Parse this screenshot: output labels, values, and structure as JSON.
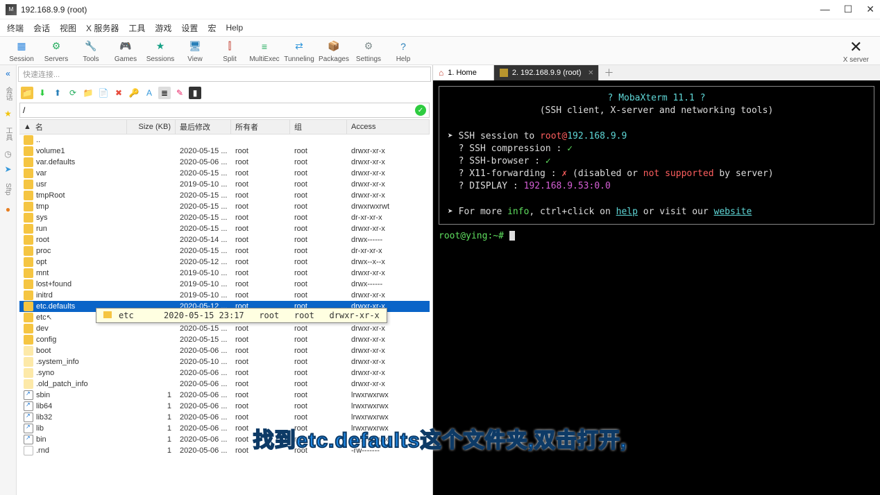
{
  "window": {
    "title": "192.168.9.9 (root)"
  },
  "menu": [
    "终端",
    "会话",
    "视图",
    "X 服务器",
    "工具",
    "游戏",
    "设置",
    "宏",
    "Help"
  ],
  "toolbar": [
    {
      "label": "Session",
      "color": "#2e86de",
      "glyph": "▦"
    },
    {
      "label": "Servers",
      "color": "#27ae60",
      "glyph": "⚙"
    },
    {
      "label": "Tools",
      "color": "#e67e22",
      "glyph": "🔧"
    },
    {
      "label": "Games",
      "color": "#8e44ad",
      "glyph": "🎮"
    },
    {
      "label": "Sessions",
      "color": "#16a085",
      "glyph": "★"
    },
    {
      "label": "View",
      "color": "#2980b9",
      "glyph": "🖥"
    },
    {
      "label": "Split",
      "color": "#c0392b",
      "glyph": "⫿"
    },
    {
      "label": "MultiExec",
      "color": "#27ae60",
      "glyph": "≡"
    },
    {
      "label": "Tunneling",
      "color": "#3498db",
      "glyph": "⇄"
    },
    {
      "label": "Packages",
      "color": "#d35400",
      "glyph": "📦"
    },
    {
      "label": "Settings",
      "color": "#7f8c8d",
      "glyph": "⚙"
    },
    {
      "label": "Help",
      "color": "#2980b9",
      "glyph": "?"
    }
  ],
  "xserver_label": "X server",
  "quickconnect_placeholder": "快速连接...",
  "current_path": "/",
  "columns": {
    "name": "名",
    "size": "Size (KB)",
    "modified": "最后修改",
    "owner": "所有者",
    "group": "组",
    "access": "Access"
  },
  "sidebar_labels": {
    "sessions": "会话",
    "tools": "工具",
    "sftp": "Sftp"
  },
  "files": [
    {
      "name": "volume1",
      "type": "folder",
      "size": "",
      "mod": "2020-05-15 ...",
      "owner": "root",
      "group": "root",
      "access": "drwxr-xr-x"
    },
    {
      "name": "var.defaults",
      "type": "folder",
      "size": "",
      "mod": "2020-05-06 ...",
      "owner": "root",
      "group": "root",
      "access": "drwxr-xr-x"
    },
    {
      "name": "var",
      "type": "folder",
      "size": "",
      "mod": "2020-05-15 ...",
      "owner": "root",
      "group": "root",
      "access": "drwxr-xr-x"
    },
    {
      "name": "usr",
      "type": "folder",
      "size": "",
      "mod": "2019-05-10 ...",
      "owner": "root",
      "group": "root",
      "access": "drwxr-xr-x"
    },
    {
      "name": "tmpRoot",
      "type": "folder",
      "size": "",
      "mod": "2020-05-15 ...",
      "owner": "root",
      "group": "root",
      "access": "drwxr-xr-x"
    },
    {
      "name": "tmp",
      "type": "folder",
      "size": "",
      "mod": "2020-05-15 ...",
      "owner": "root",
      "group": "root",
      "access": "drwxrwxrwt"
    },
    {
      "name": "sys",
      "type": "folder",
      "size": "",
      "mod": "2020-05-15 ...",
      "owner": "root",
      "group": "root",
      "access": "dr-xr-xr-x"
    },
    {
      "name": "run",
      "type": "folder",
      "size": "",
      "mod": "2020-05-15 ...",
      "owner": "root",
      "group": "root",
      "access": "drwxr-xr-x"
    },
    {
      "name": "root",
      "type": "folder",
      "size": "",
      "mod": "2020-05-14 ...",
      "owner": "root",
      "group": "root",
      "access": "drwx------"
    },
    {
      "name": "proc",
      "type": "folder",
      "size": "",
      "mod": "2020-05-15 ...",
      "owner": "root",
      "group": "root",
      "access": "dr-xr-xr-x"
    },
    {
      "name": "opt",
      "type": "folder",
      "size": "",
      "mod": "2020-05-12 ...",
      "owner": "root",
      "group": "root",
      "access": "drwx--x--x"
    },
    {
      "name": "mnt",
      "type": "folder",
      "size": "",
      "mod": "2019-05-10 ...",
      "owner": "root",
      "group": "root",
      "access": "drwxr-xr-x"
    },
    {
      "name": "lost+found",
      "type": "folder",
      "size": "",
      "mod": "2019-05-10 ...",
      "owner": "root",
      "group": "root",
      "access": "drwx------"
    },
    {
      "name": "initrd",
      "type": "folder",
      "size": "",
      "mod": "2019-05-10 ...",
      "owner": "root",
      "group": "root",
      "access": "drwxr-xr-x"
    },
    {
      "name": "etc.defaults",
      "type": "folder",
      "size": "",
      "mod": "2020-05-12 ...",
      "owner": "root",
      "group": "root",
      "access": "drwxr-xr-x",
      "selected": true
    },
    {
      "name": "etc",
      "type": "folder",
      "size": "",
      "mod": "2020-05-15 ...",
      "owner": "root",
      "group": "root",
      "access": "drwxr-xr-x",
      "cursor": true
    },
    {
      "name": "dev",
      "type": "folder",
      "size": "",
      "mod": "2020-05-15 ...",
      "owner": "root",
      "group": "root",
      "access": "drwxr-xr-x"
    },
    {
      "name": "config",
      "type": "folder",
      "size": "",
      "mod": "2020-05-15 ...",
      "owner": "root",
      "group": "root",
      "access": "drwxr-xr-x"
    },
    {
      "name": "boot",
      "type": "folder-lt",
      "size": "",
      "mod": "2020-05-06 ...",
      "owner": "root",
      "group": "root",
      "access": "drwxr-xr-x"
    },
    {
      "name": ".system_info",
      "type": "folder-lt",
      "size": "",
      "mod": "2020-05-10 ...",
      "owner": "root",
      "group": "root",
      "access": "drwxr-xr-x"
    },
    {
      "name": ".syno",
      "type": "folder-lt",
      "size": "",
      "mod": "2020-05-06 ...",
      "owner": "root",
      "group": "root",
      "access": "drwxr-xr-x"
    },
    {
      "name": ".old_patch_info",
      "type": "folder-lt",
      "size": "",
      "mod": "2020-05-06 ...",
      "owner": "root",
      "group": "root",
      "access": "drwxr-xr-x"
    },
    {
      "name": "sbin",
      "type": "link",
      "size": "1",
      "mod": "2020-05-06 ...",
      "owner": "root",
      "group": "root",
      "access": "lrwxrwxrwx"
    },
    {
      "name": "lib64",
      "type": "link",
      "size": "1",
      "mod": "2020-05-06 ...",
      "owner": "root",
      "group": "root",
      "access": "lrwxrwxrwx"
    },
    {
      "name": "lib32",
      "type": "link",
      "size": "1",
      "mod": "2020-05-06 ...",
      "owner": "root",
      "group": "root",
      "access": "lrwxrwxrwx"
    },
    {
      "name": "lib",
      "type": "link",
      "size": "1",
      "mod": "2020-05-06 ...",
      "owner": "root",
      "group": "root",
      "access": "lrwxrwxrwx"
    },
    {
      "name": "bin",
      "type": "link",
      "size": "1",
      "mod": "2020-05-06 ...",
      "owner": "root",
      "group": "root",
      "access": "lrwxrwxrwx"
    },
    {
      "name": ".rnd",
      "type": "file",
      "size": "1",
      "mod": "2020-05-06 ...",
      "owner": "root",
      "group": "root",
      "access": "-rw-------"
    }
  ],
  "tooltip": {
    "name": "etc",
    "mod": "2020-05-15 23:17",
    "owner": "root",
    "group": "root",
    "access": "drwxr-xr-x"
  },
  "tabs": {
    "home": "1. Home",
    "session": "2. 192.168.9.9 (root)"
  },
  "terminal": {
    "banner_title": "? MobaXterm 11.1 ?",
    "banner_sub": "(SSH client, X-server and networking tools)",
    "ssh_line_prefix": "SSH session to ",
    "ssh_user": "root@",
    "ssh_host": "192.168.9.9",
    "compression": "? SSH compression : ",
    "browser": "? SSH-browser     : ",
    "x11_label": "? X11-forwarding  : ",
    "x11_status": "  (disabled or ",
    "x11_not": "not supported",
    "x11_tail": " by server)",
    "display_label": "? DISPLAY         : ",
    "display_val": "192.168.9.53:0.0",
    "info_line1": "➤ For more ",
    "info_word": "info",
    "info_line2": ", ctrl+click on ",
    "help": "help",
    "info_line3": " or visit our ",
    "website": "website",
    "prompt": "root@ying:~# "
  },
  "subtitle": "找到etc.defaults这个文件夹,双击打开,"
}
